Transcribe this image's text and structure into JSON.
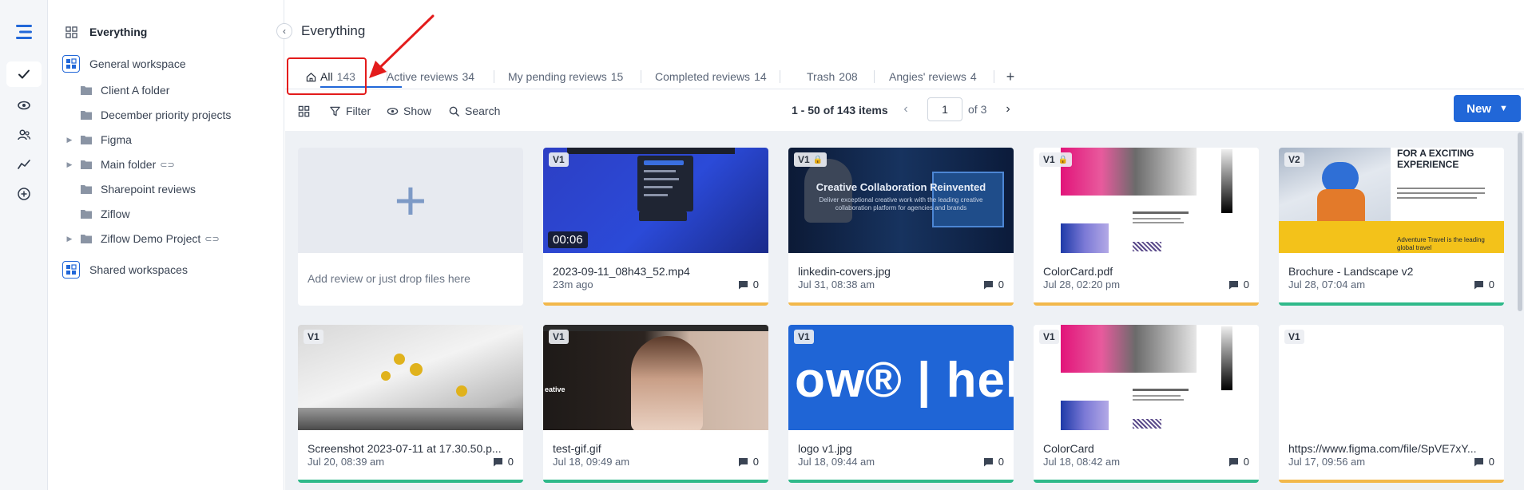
{
  "sidebar": {
    "everything": "Everything",
    "general_workspace": "General workspace",
    "folders": [
      {
        "label": "Client A folder",
        "has_caret": false,
        "linked": false
      },
      {
        "label": "December priority projects",
        "has_caret": false,
        "linked": false
      },
      {
        "label": "Figma",
        "has_caret": true,
        "linked": false
      },
      {
        "label": "Main folder",
        "has_caret": true,
        "linked": true
      },
      {
        "label": "Sharepoint reviews",
        "has_caret": false,
        "linked": false
      },
      {
        "label": "Ziflow",
        "has_caret": false,
        "linked": false
      },
      {
        "label": "Ziflow Demo Project",
        "has_caret": true,
        "linked": true
      }
    ],
    "shared_workspaces": "Shared workspaces"
  },
  "header": {
    "title": "Everything"
  },
  "tabs": [
    {
      "label": "All",
      "count": "143"
    },
    {
      "label": "Active reviews",
      "count": "34"
    },
    {
      "label": "My pending reviews",
      "count": "15"
    },
    {
      "label": "Completed reviews",
      "count": "14"
    },
    {
      "label": "Trash",
      "count": "208"
    },
    {
      "label": "Angies' reviews",
      "count": "4"
    }
  ],
  "tab_add": "+",
  "toolbar": {
    "filter": "Filter",
    "show": "Show",
    "search": "Search",
    "pager_text": "1 - 50 of 143 items",
    "page": "1",
    "of_pages": "of 3",
    "new_label": "New"
  },
  "add_card": {
    "text": "Add review or just drop files here"
  },
  "cards": [
    {
      "version": "V1",
      "name": "2023-09-11_08h43_52.mp4",
      "date": "23m ago",
      "comments": "0",
      "duration": "00:06",
      "status_color": "#f2b84b",
      "locked": false
    },
    {
      "version": "V1",
      "name": "linkedin-covers.jpg",
      "date": "Jul 31, 08:38 am",
      "comments": "0",
      "status_color": "#f2b84b",
      "locked": true,
      "thumb_title": "Creative Collaboration Reinvented",
      "thumb_sub": "Deliver exceptional creative work with the leading creative collaboration platform for agencies and brands"
    },
    {
      "version": "V1",
      "name": "ColorCard.pdf",
      "date": "Jul 28, 02:20 pm",
      "comments": "0",
      "status_color": "#f2b84b",
      "locked": true
    },
    {
      "version": "V2",
      "name": "Brochure - Landscape v2",
      "date": "Jul 28, 07:04 am",
      "comments": "0",
      "status_color": "#2fb98a",
      "locked": false,
      "thumb_title": "FOR A EXCITING EXPERIENCE",
      "thumb_banner": "Adventure Travel is the leading global travel"
    },
    {
      "version": "V1",
      "name": "Screenshot 2023-07-11 at 17.30.50.p...",
      "date": "Jul 20, 08:39 am",
      "comments": "0",
      "status_color": "#2fb98a",
      "locked": false
    },
    {
      "version": "V1",
      "name": "test-gif.gif",
      "date": "Jul 18, 09:49 am",
      "comments": "0",
      "status_color": "#2fb98a",
      "locked": false,
      "thumb_word": "eative"
    },
    {
      "version": "V1",
      "name": "logo v1.jpg",
      "date": "Jul 18, 09:44 am",
      "comments": "0",
      "status_color": "#2fb98a",
      "locked": false,
      "thumb_word": "ow® | hel"
    },
    {
      "version": "V1",
      "name": "ColorCard",
      "date": "Jul 18, 08:42 am",
      "comments": "0",
      "status_color": "#2fb98a",
      "locked": false
    },
    {
      "version": "V1",
      "name": "https://www.figma.com/file/SpVE7xY...",
      "date": "Jul 17, 09:56 am",
      "comments": "0",
      "status_color": "#f2b84b",
      "locked": false
    }
  ],
  "colors": {
    "accent": "#2167d8",
    "highlight": "#e31b1b"
  }
}
